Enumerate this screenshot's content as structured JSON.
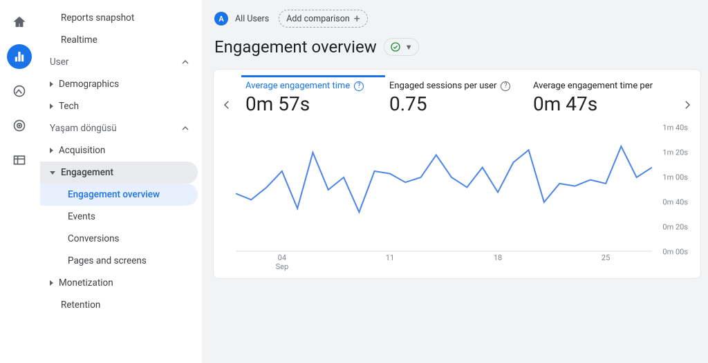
{
  "topbar": {
    "audience_badge": "A",
    "audience_label": "All Users",
    "add_comparison": "Add comparison"
  },
  "page": {
    "title": "Engagement overview"
  },
  "sidebar": {
    "items": [
      {
        "label": "Reports snapshot",
        "type": "item"
      },
      {
        "label": "Realtime",
        "type": "item"
      },
      {
        "label": "User",
        "type": "head"
      },
      {
        "label": "Demographics",
        "type": "item",
        "caret": "right"
      },
      {
        "label": "Tech",
        "type": "item",
        "caret": "right"
      },
      {
        "label": "Yaşam döngüsü",
        "type": "head"
      },
      {
        "label": "Acquisition",
        "type": "item",
        "caret": "right"
      },
      {
        "label": "Engagement",
        "type": "item",
        "caret": "down",
        "sel": true
      },
      {
        "label": "Engagement overview",
        "type": "sub",
        "sel": true
      },
      {
        "label": "Events",
        "type": "sub"
      },
      {
        "label": "Conversions",
        "type": "sub"
      },
      {
        "label": "Pages and screens",
        "type": "sub"
      },
      {
        "label": "Monetization",
        "type": "item",
        "caret": "right"
      },
      {
        "label": "Retention",
        "type": "item",
        "caret": "blank"
      }
    ]
  },
  "metrics": [
    {
      "title": "Average engagement time",
      "value": "0m 57s",
      "help": true,
      "active": true
    },
    {
      "title": "Engaged sessions per user",
      "value": "0.75",
      "help": true
    },
    {
      "title": "Average engagement time per",
      "value": "0m 47s",
      "help": false
    }
  ],
  "chart_data": {
    "type": "line",
    "title": "Average engagement time",
    "ylabel": "",
    "xlabel": "",
    "ylim": [
      0,
      100
    ],
    "y_ticks": [
      "0m 00s",
      "0m 20s",
      "0m 40s",
      "1m 00s",
      "1m 20s",
      "1m 40s"
    ],
    "x_ticks": [
      {
        "major": "04",
        "minor": "Sep",
        "at": 4
      },
      {
        "major": "11",
        "minor": "",
        "at": 11
      },
      {
        "major": "18",
        "minor": "",
        "at": 18
      },
      {
        "major": "25",
        "minor": "",
        "at": 25
      }
    ],
    "x": [
      1,
      2,
      3,
      4,
      5,
      6,
      7,
      8,
      9,
      10,
      11,
      12,
      13,
      14,
      15,
      16,
      17,
      18,
      19,
      20,
      21,
      22,
      23,
      24,
      25,
      26,
      27,
      28
    ],
    "values": [
      47,
      42,
      52,
      65,
      35,
      80,
      50,
      60,
      32,
      65,
      63,
      56,
      60,
      78,
      60,
      52,
      68,
      48,
      72,
      82,
      40,
      55,
      53,
      58,
      55,
      85,
      60,
      68
    ],
    "color": "#4f87e6"
  }
}
